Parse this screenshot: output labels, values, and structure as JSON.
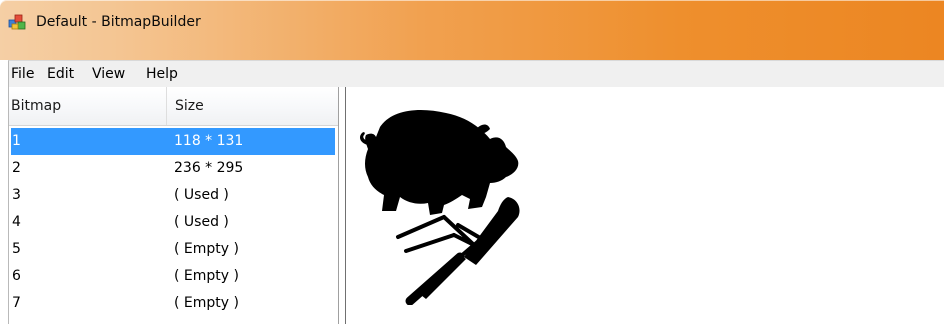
{
  "window": {
    "title": "Default - BitmapBuilder",
    "app_icon": "bitmapbuilder-app-icon",
    "accent": "#ee8f2d"
  },
  "menubar": {
    "items": [
      {
        "label": "File"
      },
      {
        "label": "Edit"
      },
      {
        "label": "View"
      },
      {
        "label": "Help"
      }
    ]
  },
  "bitmap_list": {
    "columns": [
      "Bitmap",
      "Size"
    ],
    "selected_index": 0,
    "selection_color": "#3399ff",
    "rows": [
      {
        "bitmap": "1",
        "size": "118 * 131"
      },
      {
        "bitmap": "2",
        "size": "236 * 295"
      },
      {
        "bitmap": "3",
        "size": "( Used )"
      },
      {
        "bitmap": "4",
        "size": "( Used )"
      },
      {
        "bitmap": "5",
        "size": "( Empty )"
      },
      {
        "bitmap": "6",
        "size": "( Empty )"
      },
      {
        "bitmap": "7",
        "size": "( Empty )"
      }
    ]
  },
  "preview": {
    "image": "pig-with-crossed-fork-and-knife",
    "ink_color": "#000000"
  }
}
